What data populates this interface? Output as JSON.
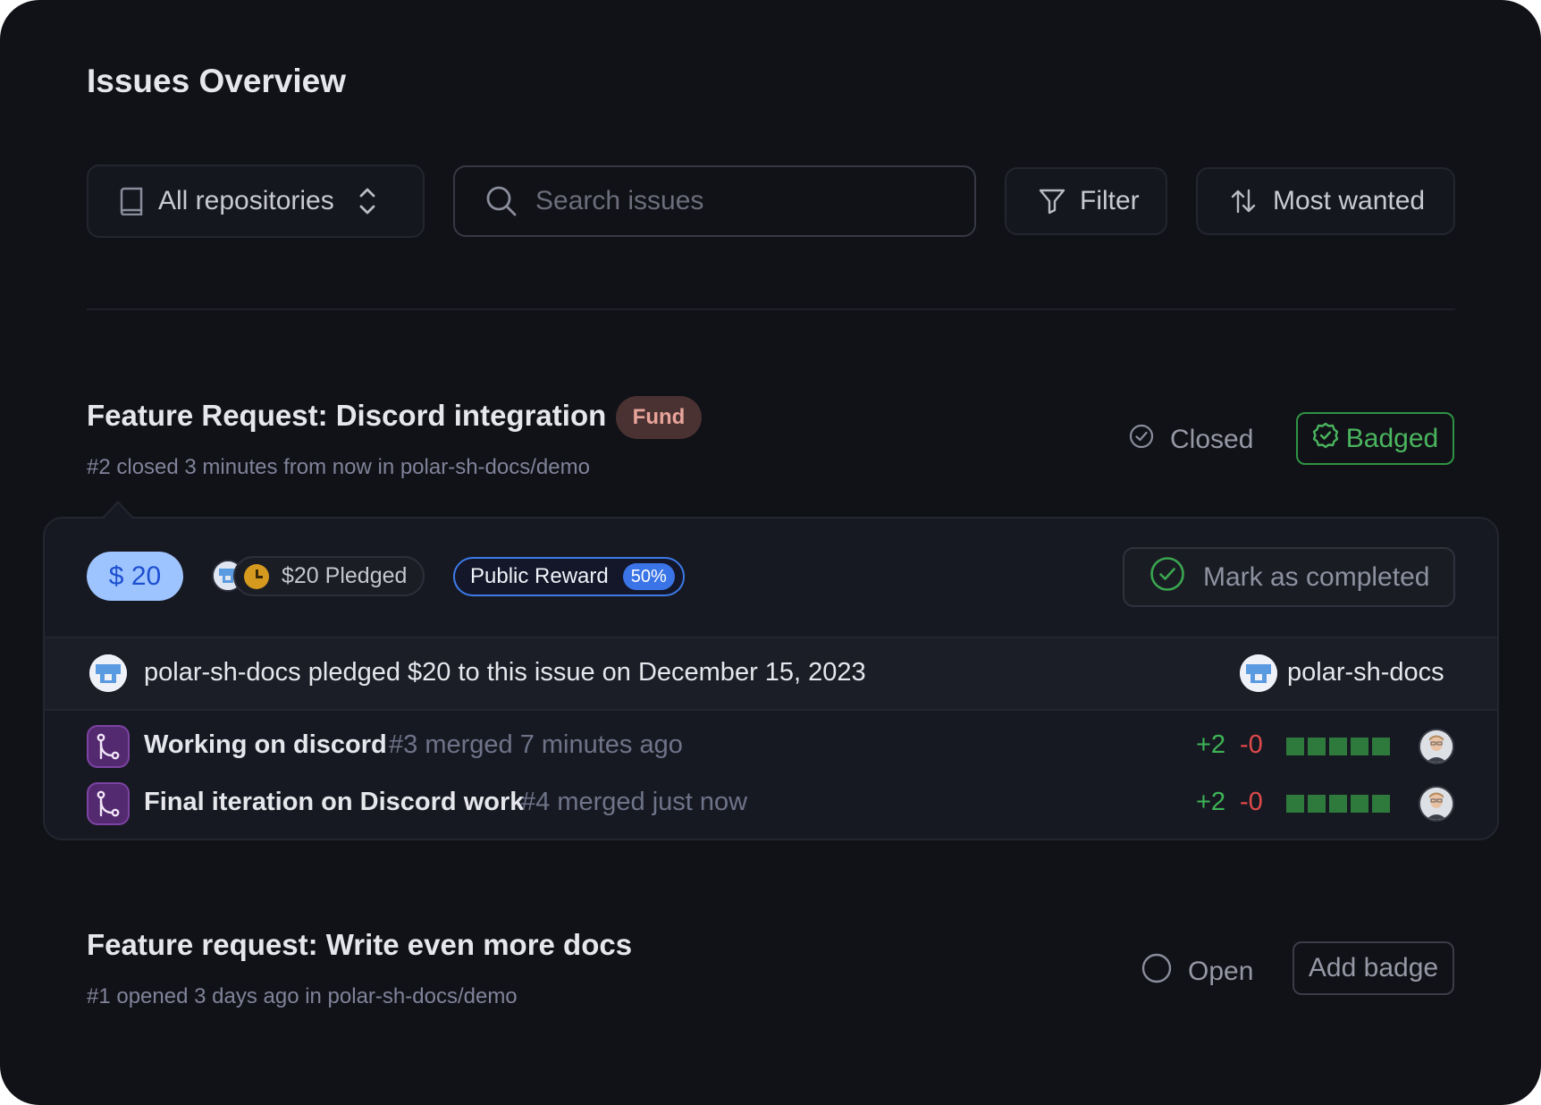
{
  "page": {
    "title": "Issues Overview"
  },
  "toolbar": {
    "repo_select": {
      "label": "All repositories",
      "icon": "book-icon"
    },
    "search": {
      "placeholder": "Search issues",
      "icon": "search-icon"
    },
    "filter": {
      "label": "Filter",
      "icon": "funnel-icon"
    },
    "sort": {
      "label": "Most wanted",
      "icon": "sort-arrows-icon"
    }
  },
  "issues": [
    {
      "title": "Feature Request: Discord integration",
      "meta": "#2 closed 3 minutes from now in polar-sh-docs/demo",
      "fund_badge": "Fund",
      "state": "Closed",
      "badge_button": "Badged",
      "funding": {
        "amount": "$ 20",
        "pledged": "$20 Pledged",
        "reward_label": "Public Reward",
        "reward_percent": "50%",
        "complete_button": "Mark as completed"
      },
      "pledge": {
        "text": "polar-sh-docs pledged $20 to this issue on December 15, 2023",
        "pledger": "polar-sh-docs"
      },
      "pull_requests": [
        {
          "title": "Working on discord",
          "meta": "#3 merged 7 minutes ago",
          "additions": "+2",
          "deletions": "-0"
        },
        {
          "title": "Final iteration on Discord work",
          "meta": "#4 merged just now",
          "additions": "+2",
          "deletions": "-0"
        }
      ]
    },
    {
      "title": "Feature request: Write even more docs",
      "meta": "#1 opened 3 days ago in polar-sh-docs/demo",
      "state": "Open",
      "badge_button": "Add badge"
    }
  ],
  "colors": {
    "background": "#111217",
    "closed_badge": "#2f9344",
    "fund_badge": "#4a3232",
    "amount_pill": "#9ec4ff",
    "reward_border": "#3c7ae8",
    "additions": "#3db455",
    "deletions": "#e04a4a",
    "pr_icon": "#53296f"
  }
}
